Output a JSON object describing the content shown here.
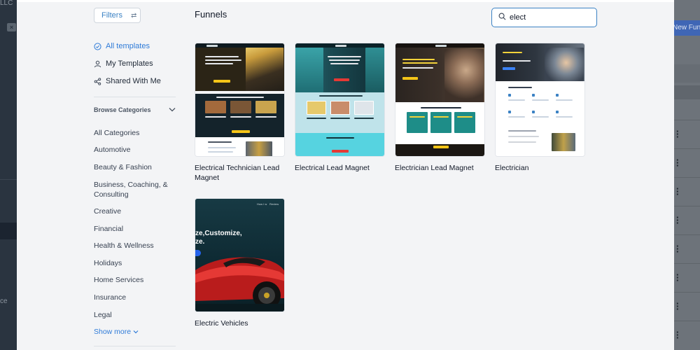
{
  "background": {
    "left_text_top": "LLC",
    "left_text_bottom": "ce",
    "new_button_label": "New Funn"
  },
  "sidebar": {
    "filters_label": "Filters",
    "nav": [
      {
        "label": "All templates",
        "icon": "check-circle-icon",
        "active": true
      },
      {
        "label": "My Templates",
        "icon": "user-icon",
        "active": false
      },
      {
        "label": "Shared With Me",
        "icon": "share-icon",
        "active": false
      }
    ],
    "browse_label": "Browse Categories",
    "categories": [
      "All Categories",
      "Automotive",
      "Beauty & Fashion",
      "Business, Coaching, & Consulting",
      "Creative",
      "Financial",
      "Health & Wellness",
      "Holidays",
      "Home Services",
      "Insurance",
      "Legal"
    ],
    "show_more_label": "Show more"
  },
  "main": {
    "title": "Funnels",
    "search_value": "elect",
    "templates": [
      {
        "name": "Electrical Technician Lead Magnet"
      },
      {
        "name": "Electrical Lead Magnet"
      },
      {
        "name": "Electrician Lead Magnet"
      },
      {
        "name": "Electrician"
      },
      {
        "name": "Electric Vehicles"
      }
    ],
    "car_thumb_nav": [
      "How I w",
      "Review"
    ],
    "car_thumb_headline_1": "ze,Customize,",
    "car_thumb_headline_2": "ze."
  },
  "colors": {
    "accent": "#2f7bd8",
    "modal_bg": "#f3f4f6",
    "overlay": "#1f2a36"
  }
}
